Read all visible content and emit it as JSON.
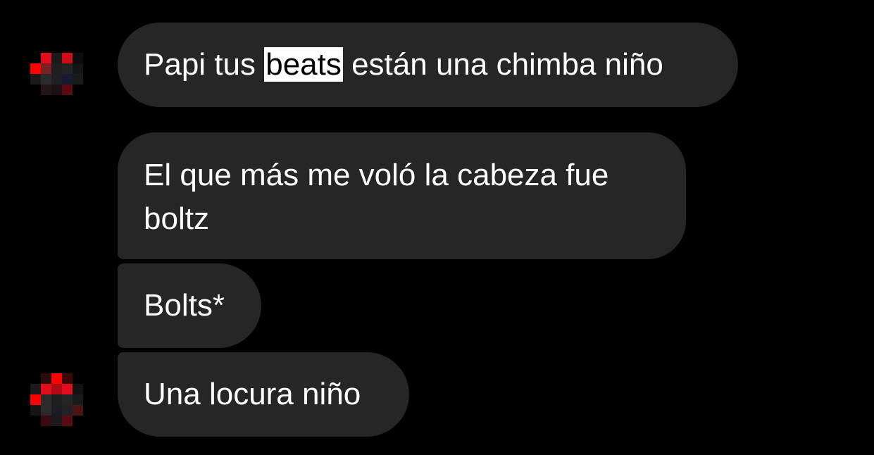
{
  "messages": [
    {
      "parts": [
        "Papi tus ",
        "beats",
        " están una chimba niño"
      ],
      "highlighted": "beats"
    },
    {
      "lines": [
        "El que más me voló la cabeza fue",
        "boltz"
      ]
    },
    {
      "text": "Bolts*"
    },
    {
      "text": "Una locura niño"
    }
  ],
  "colors": {
    "background": "#000000",
    "bubble": "#262626",
    "text": "#ffffff",
    "highlight_bg": "#ffffff",
    "highlight_text": "#000000",
    "avatar_red": "#e10d1c"
  },
  "avatars": [
    {
      "icon": "pixelated-profile-avatar-icon"
    },
    {
      "icon": "pixelated-profile-avatar-icon"
    }
  ]
}
